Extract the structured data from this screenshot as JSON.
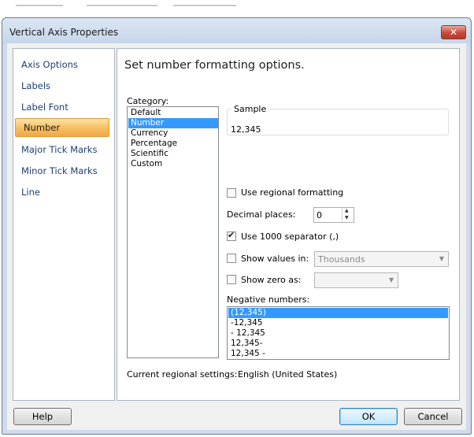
{
  "window": {
    "title": "Vertical Axis Properties"
  },
  "nav": {
    "items": [
      {
        "label": "Axis Options",
        "selected": false
      },
      {
        "label": "Labels",
        "selected": false
      },
      {
        "label": "Label Font",
        "selected": false
      },
      {
        "label": "Number",
        "selected": true
      },
      {
        "label": "Major Tick Marks",
        "selected": false
      },
      {
        "label": "Minor Tick Marks",
        "selected": false
      },
      {
        "label": "Line",
        "selected": false
      }
    ]
  },
  "content": {
    "heading": "Set number formatting options.",
    "category_label": "Category:",
    "categories": [
      {
        "label": "Default",
        "selected": false
      },
      {
        "label": "Number",
        "selected": true
      },
      {
        "label": "Currency",
        "selected": false
      },
      {
        "label": "Percentage",
        "selected": false
      },
      {
        "label": "Scientific",
        "selected": false
      },
      {
        "label": "Custom",
        "selected": false
      }
    ],
    "sample_label": "Sample",
    "sample_value": "12,345",
    "use_regional_label": "Use regional formatting",
    "use_regional_checked": false,
    "decimal_label": "Decimal places:",
    "decimal_value": "0",
    "separator_label": "Use 1000 separator (,)",
    "separator_checked": true,
    "show_values_label": "Show values in:",
    "show_values_checked": false,
    "show_values_option": "Thousands",
    "show_zero_label": "Show zero as:",
    "show_zero_checked": false,
    "show_zero_option": "",
    "negative_label": "Negative numbers:",
    "negative_options": [
      {
        "label": "(12,345)",
        "selected": true
      },
      {
        "label": "-12,345",
        "selected": false
      },
      {
        "label": "- 12,345",
        "selected": false
      },
      {
        "label": "12,345-",
        "selected": false
      },
      {
        "label": "12,345 -",
        "selected": false
      }
    ],
    "regional_caption": "Current regional settings:",
    "regional_value": "English (United States)"
  },
  "buttons": {
    "help": "Help",
    "ok": "OK",
    "cancel": "Cancel"
  },
  "colors": {
    "selection": "#3399ff",
    "nav_selected": "#f7c064",
    "title_bar": "#cfdbea"
  }
}
